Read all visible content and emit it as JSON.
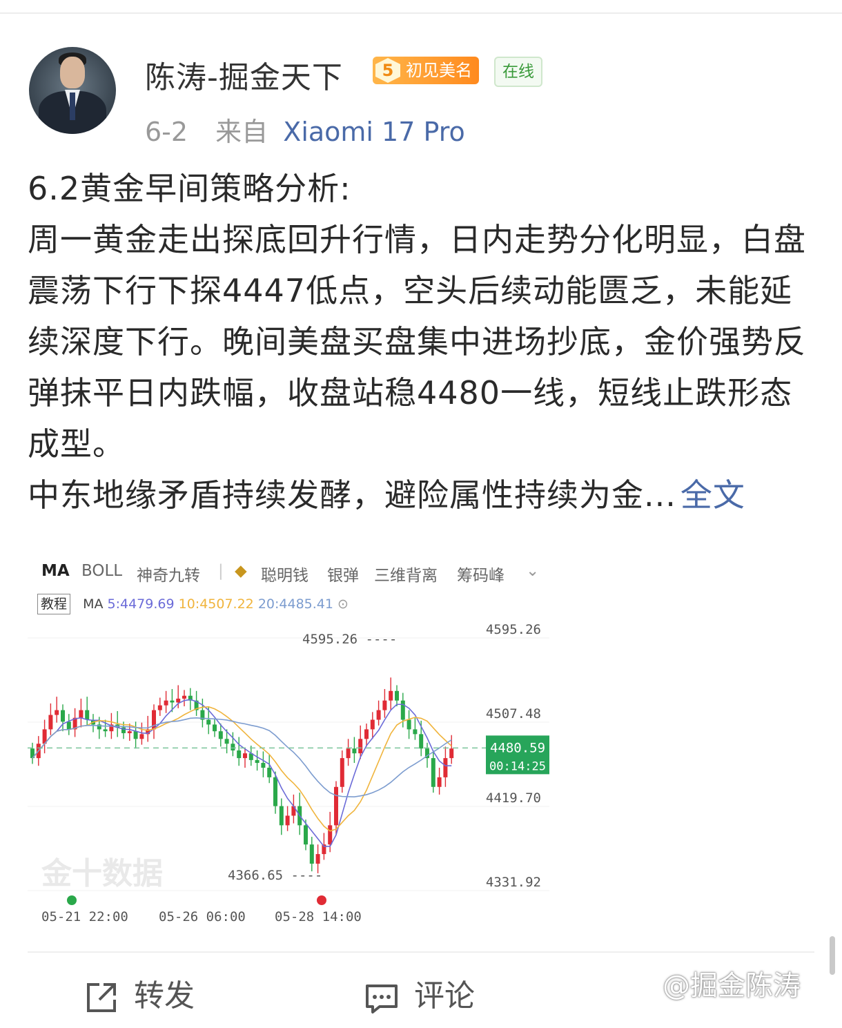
{
  "author": {
    "name": "陈涛-掘金天下",
    "vip_level": "5",
    "badge": "初见美名",
    "online": "在线"
  },
  "meta": {
    "date": "6-2",
    "from_label": "来自",
    "device": "Xiaomi 17 Pro"
  },
  "post": {
    "title": "6.2黄金早间策略分析:",
    "paragraph": "周一黄金走出探底回升行情，日内走势分化明显，白盘震荡下行下探4447低点，空头后续动能匮乏，未能延续深度下行。晚间美盘买盘集中进场抄底，金价强势反弹抹平日内跌幅，收盘站稳4480一线，短线止跌形态成型。",
    "paragraph2": "中东地缘矛盾持续发酵，避险属性持续为金...",
    "fulltext_link": "全文"
  },
  "chart": {
    "toolbar": [
      "MA",
      "BOLL",
      "神奇九转",
      "聪明钱",
      "银弹",
      "三维背离",
      "筹码峰"
    ],
    "tutorial": "教程",
    "ma_prefix": "MA",
    "ma5": "5:4479.69",
    "ma10": "10:4507.22",
    "ma20": "20:4485.41",
    "colors": {
      "ma5": "#6b6bd8",
      "ma10": "#f0b43c",
      "ma20": "#7c9ccf",
      "up": "#e02b35",
      "down": "#2aa84a"
    },
    "watermark": "金十数据"
  },
  "chart_data": {
    "type": "candlestick",
    "y_ticks": [
      "4595.26",
      "4507.48",
      "4419.70",
      "4331.92"
    ],
    "y_range": [
      4331.92,
      4595.26
    ],
    "high_label": "4595.26",
    "low_label": "4366.65",
    "current_price": "4480.59",
    "countdown": "00:14:25",
    "x_labels": [
      "05-21 22:00",
      "05-26 06:00",
      "05-28 14:00"
    ]
  },
  "actions": {
    "repost": "转发",
    "comment": "评论",
    "watermark": "@掘金陈涛"
  }
}
